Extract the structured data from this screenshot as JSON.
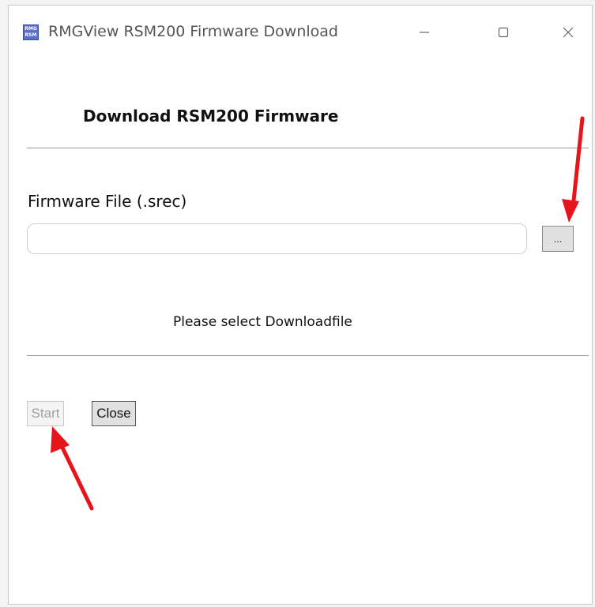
{
  "window": {
    "title": "RMGView RSM200 Firmware Download",
    "icon_name": "rmg-rsm-app-icon",
    "icon_text_top": "RMG",
    "icon_text_bottom": "RSM",
    "controls": [
      "minimize-icon",
      "maximize-icon",
      "close-icon"
    ]
  },
  "header": {
    "title": "Download RSM200 Firmware"
  },
  "firmware_field": {
    "label": "Firmware File (.srec)",
    "value": "",
    "browse_label": "..."
  },
  "status": {
    "message": "Please select Downloadfile"
  },
  "buttons": {
    "start_label": "Start",
    "start_enabled": false,
    "close_label": "Close"
  },
  "colors": {
    "annotation_arrow": "#e8141b",
    "window_background": "#ffffff",
    "button_face": "#e1e1e1",
    "disabled_text": "#a0a0a0"
  }
}
